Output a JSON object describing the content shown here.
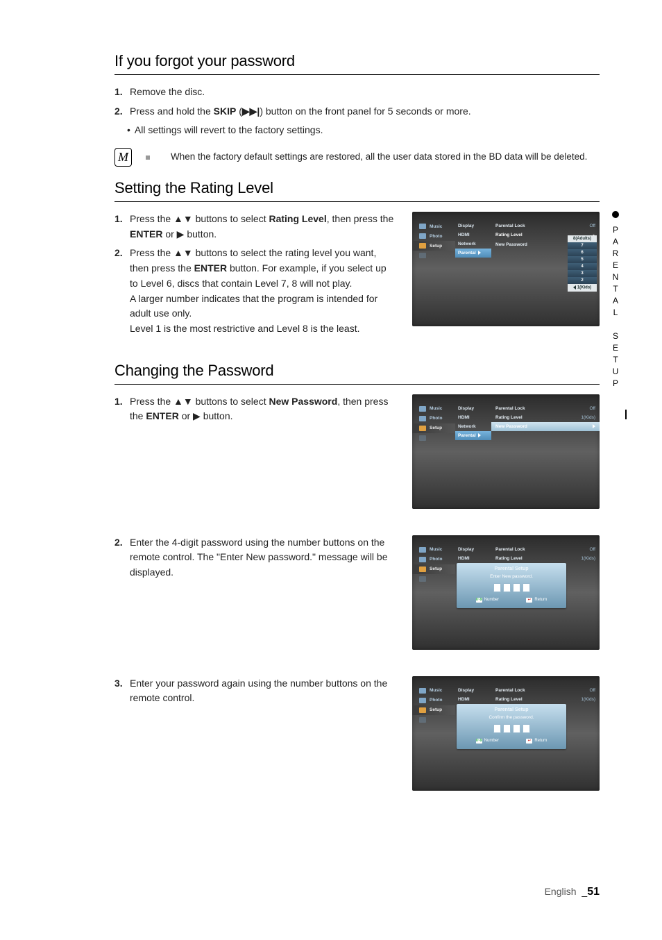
{
  "sections": {
    "forgot": {
      "heading": "If you forgot your password",
      "step1_num": "1.",
      "step1_text": "Remove the disc.",
      "step2_num": "2.",
      "step2_prefix": "Press and hold the ",
      "step2_skip": "SKIP",
      "step2_paren_open": " (",
      "step2_skip_glyph": "▶▶|",
      "step2_suffix": ") button on the front panel for 5 seconds or more.",
      "step2_sub_bullet": "•",
      "step2_sub_text": "All settings will revert to the factory settings.",
      "note_icon": "M",
      "note_bullet": "▪",
      "note_text": "When the factory default settings are restored, all the user data stored in the BD data will be deleted."
    },
    "rating": {
      "heading": "Setting the Rating Level",
      "step1_num": "1.",
      "step1_a": "Press the ▲▼ buttons to select ",
      "step1_b_strong": "Rating Level",
      "step1_c": ", then press the ",
      "step1_d_strong": "ENTER",
      "step1_e": " or ▶ button.",
      "step2_num": "2.",
      "step2_a": "Press the ▲▼ buttons to select the rating level you want, then press the ",
      "step2_b_strong": "ENTER",
      "step2_c": " button. For example, if you select up to Level 6, discs that contain Level 7, 8 will not play.",
      "step2_d": "A larger number indicates that the program is intended for adult use only.",
      "step2_e": "Level 1 is the most restrictive and Level 8 is the least."
    },
    "password": {
      "heading": "Changing the Password",
      "step1_num": "1.",
      "step1_a": "Press the ▲▼ buttons to select ",
      "step1_b_strong": "New Password",
      "step1_c": ", then press the ",
      "step1_d_strong": "ENTER",
      "step1_e": " or ▶ button.",
      "step2_num": "2.",
      "step2_text": "Enter the 4-digit password using the number buttons on the remote control. The \"Enter New password.\" message will be displayed.",
      "step3_num": "3.",
      "step3_text": "Enter your password again using the number buttons on the remote control."
    }
  },
  "side_tab": "PARENTAL SETUP",
  "footer": {
    "lang": "English",
    "sep": "_",
    "page": "51"
  },
  "ui": {
    "sidebar": {
      "music": "Music",
      "photo": "Photo",
      "setup": "Setup"
    },
    "mid": {
      "display": "Display",
      "hdmi": "HDMI",
      "network": "Network",
      "parental": "Parental"
    },
    "opts": {
      "parental_lock": "Parental Lock",
      "off": "Off",
      "rating_level": "Rating Level",
      "one_kids": "1(Kids)",
      "new_password": "New Password"
    },
    "ratings": [
      "8(Adults)",
      "7",
      "6",
      "5",
      "4",
      "3",
      "2",
      "1(Kids)"
    ],
    "dialog": {
      "title": "Parental Setup",
      "enter_new": "Enter New password.",
      "confirm": "Confirm the password.",
      "number_key": "0~9",
      "number": "Number",
      "return_key": "↩",
      "return": "Return"
    }
  }
}
